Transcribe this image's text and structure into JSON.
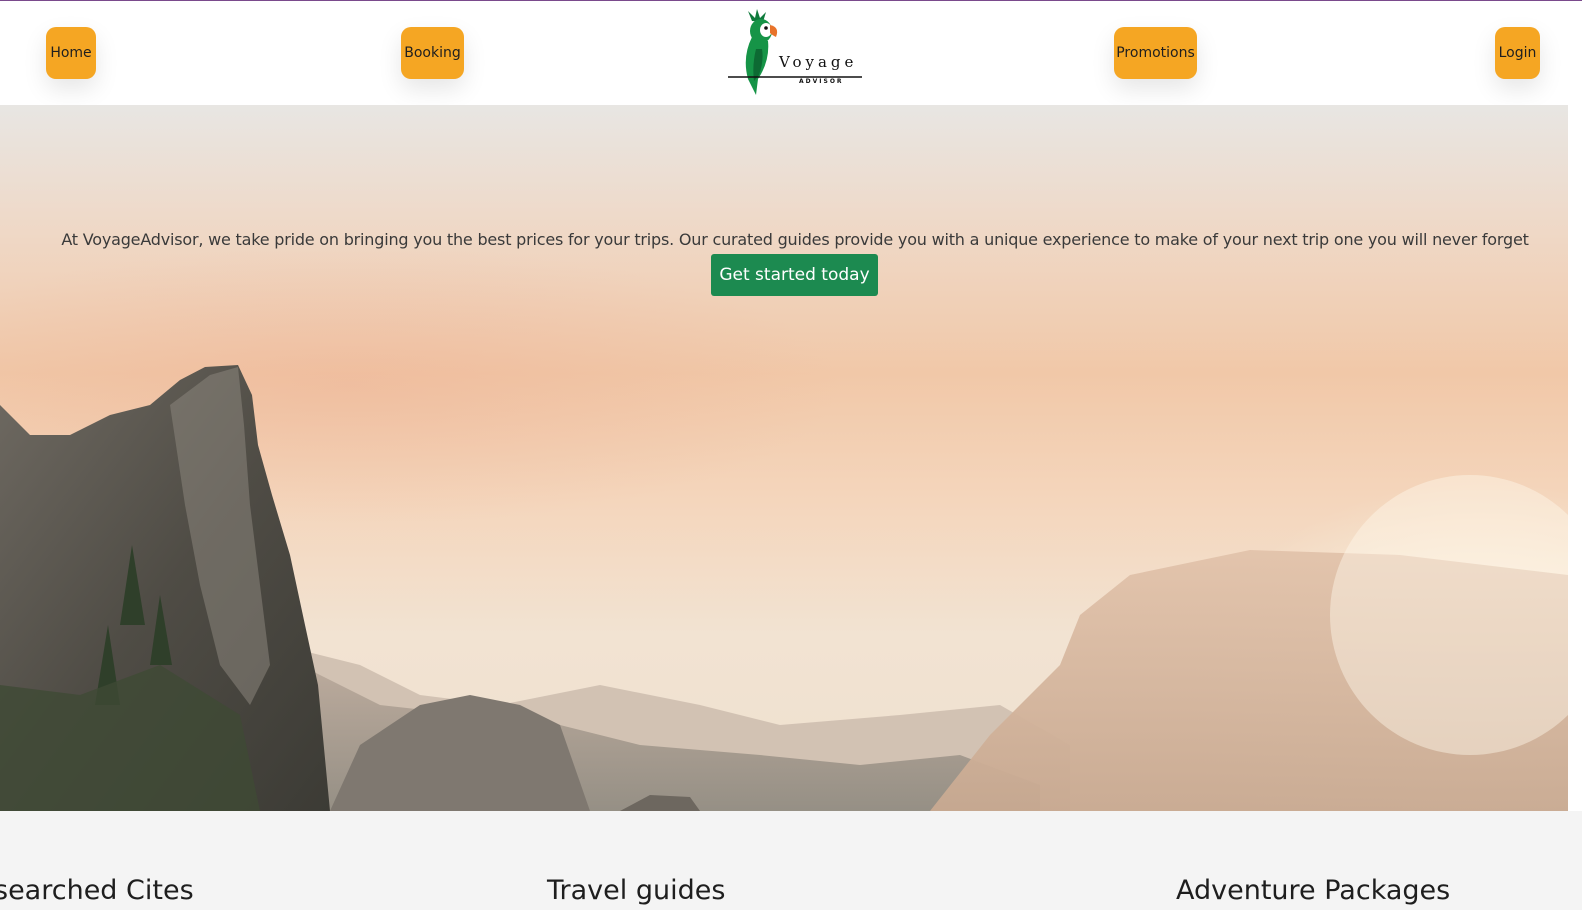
{
  "nav": {
    "home_label": "Home",
    "booking_label": "Booking",
    "promotions_label": "Promotions",
    "login_label": "Login",
    "logo": {
      "name": "Voyage",
      "tagline": "ADVISOR",
      "icon": "parrot-icon"
    }
  },
  "hero": {
    "text": "At VoyageAdvisor, we take pride on bringing you the best prices for your trips. Our curated guides provide you with a unique experience to make of your next trip one you will never forget",
    "cta_label": "Get started today"
  },
  "sections": {
    "left_heading": "searched Cites",
    "middle_heading": "Travel guides",
    "right_heading": "Adventure Packages"
  },
  "colors": {
    "nav_button": "#f5a623",
    "cta": "#1c8a50",
    "page_background": "#f4f4f4"
  }
}
